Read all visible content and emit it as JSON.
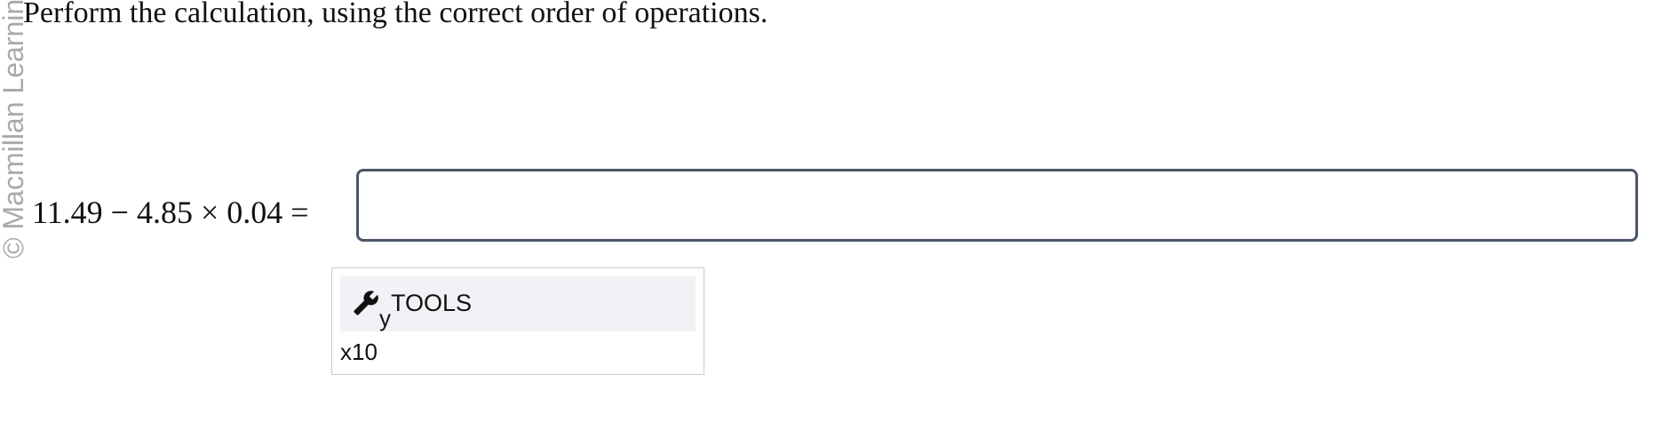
{
  "watermark": "© Macmillan Learning",
  "question": {
    "instruction": "Perform the calculation, using the correct order of operations.",
    "expression": "11.49 − 4.85 × 0.04 ="
  },
  "answer": {
    "value": "",
    "placeholder": ""
  },
  "tools": {
    "icon": "wrench-icon",
    "subscript": "y",
    "label": "TOOLS",
    "x10_label": "x10"
  }
}
